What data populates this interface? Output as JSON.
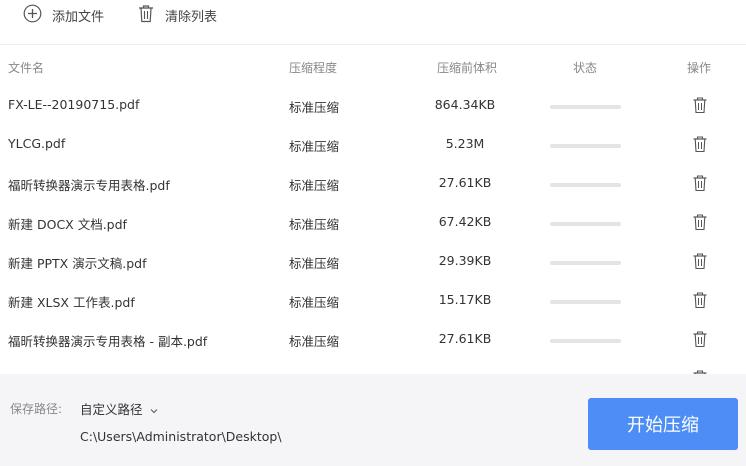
{
  "toolbar": {
    "add_label": "添加文件",
    "add_icon": "plus-circle-icon",
    "clear_label": "清除列表",
    "clear_icon": "trash-icon"
  },
  "table": {
    "headers": {
      "name": "文件名",
      "level": "压缩程度",
      "size": "压缩前体积",
      "status": "状态",
      "op": "操作"
    },
    "rows": [
      {
        "name": "FX-LE--20190715.pdf",
        "level": "标准压缩",
        "size": "864.34KB",
        "progress": 0
      },
      {
        "name": "YLCG.pdf",
        "level": "标准压缩",
        "size": "5.23M",
        "progress": 0
      },
      {
        "name": "福昕转换器演示专用表格.pdf",
        "level": "标准压缩",
        "size": "27.61KB",
        "progress": 0
      },
      {
        "name": "新建 DOCX 文档.pdf",
        "level": "标准压缩",
        "size": "67.42KB",
        "progress": 0
      },
      {
        "name": "新建 PPTX 演示文稿.pdf",
        "level": "标准压缩",
        "size": "29.39KB",
        "progress": 0
      },
      {
        "name": "新建 XLSX 工作表.pdf",
        "level": "标准压缩",
        "size": "15.17KB",
        "progress": 0
      },
      {
        "name": "福昕转换器演示专用表格 - 副本.pdf",
        "level": "标准压缩",
        "size": "27.61KB",
        "progress": 0
      }
    ]
  },
  "footer": {
    "save_label": "保存路径:",
    "save_option": "自定义路径",
    "save_path": "C:\\Users\\Administrator\\Desktop\\",
    "start_label": "开始压缩"
  },
  "colors": {
    "accent": "#4c8df6",
    "progress_track": "#e4e4e4",
    "footer_bg": "#f5f5f7"
  }
}
